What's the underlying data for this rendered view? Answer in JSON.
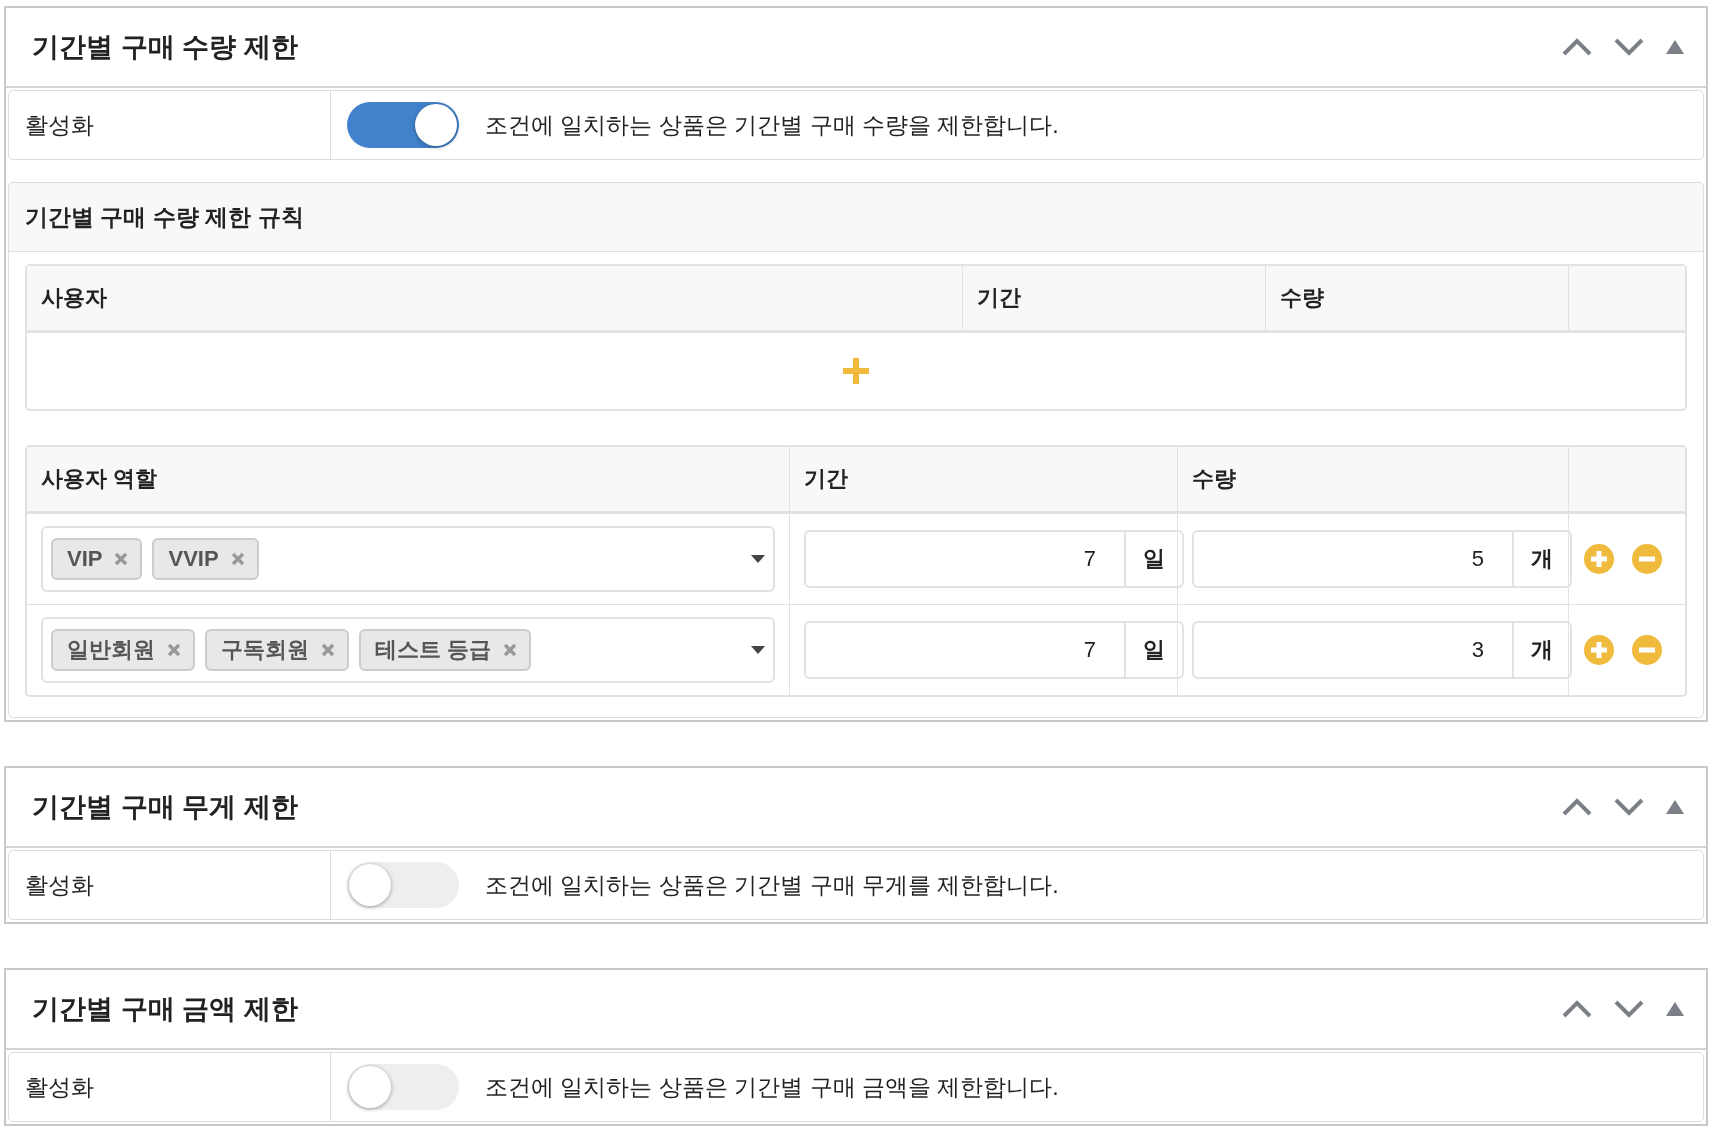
{
  "sections": [
    {
      "title": "기간별 구매 수량 제한",
      "activation": {
        "label": "활성화",
        "on": true,
        "description": "조건에 일치하는 상품은 기간별 구매 수량을 제한합니다."
      },
      "rules": {
        "title": "기간별 구매 수량 제한 규칙",
        "tables": [
          {
            "kind": "empty",
            "columns": [
              "사용자",
              "기간",
              "수량"
            ]
          },
          {
            "kind": "rows",
            "columns": [
              "사용자 역할",
              "기간",
              "수량"
            ],
            "rows": [
              {
                "tags": [
                  "VIP",
                  "VVIP"
                ],
                "period": "7",
                "period_unit": "일",
                "quantity": "5",
                "quantity_unit": "개"
              },
              {
                "tags": [
                  "일반회원",
                  "구독회원",
                  "테스트 등급"
                ],
                "period": "7",
                "period_unit": "일",
                "quantity": "3",
                "quantity_unit": "개"
              }
            ]
          }
        ]
      }
    },
    {
      "title": "기간별 구매 무게 제한",
      "activation": {
        "label": "활성화",
        "on": false,
        "description": "조건에 일치하는 상품은 기간별 구매 무게를 제한합니다."
      }
    },
    {
      "title": "기간별 구매 금액 제한",
      "activation": {
        "label": "활성화",
        "on": false,
        "description": "조건에 일치하는 상품은 기간별 구매 금액을 제한합니다."
      }
    }
  ]
}
